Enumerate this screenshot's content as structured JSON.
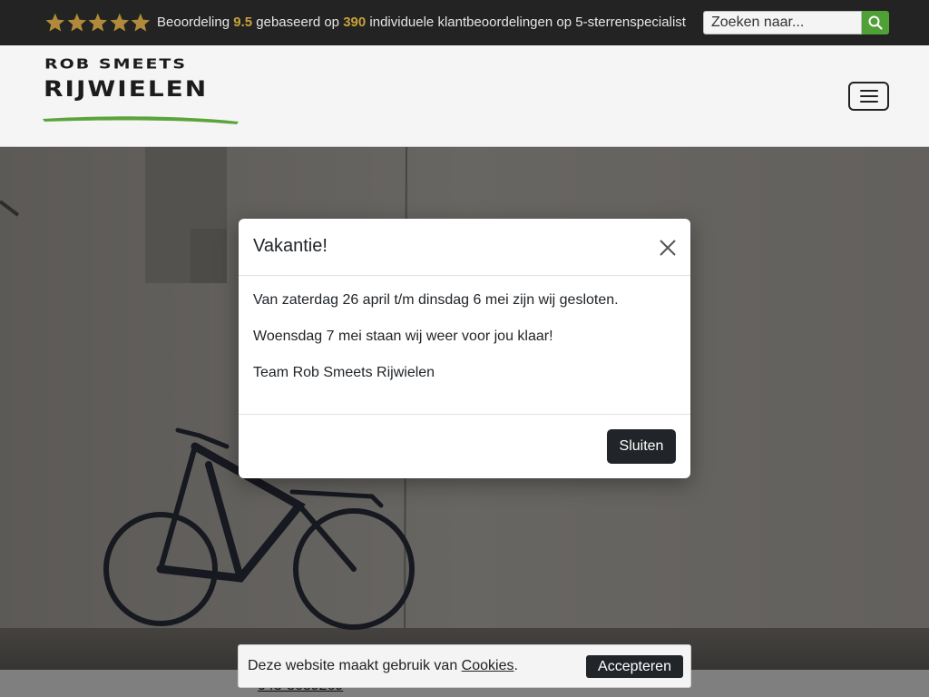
{
  "topbar": {
    "stars_count": 5,
    "star_icon": "star-icon",
    "rating_prefix": "Beoordeling",
    "rating_score": "9.5",
    "rating_middle": "gebaseerd op",
    "review_count": "390",
    "rating_suffix": "individuele klantbeoordelingen op 5-sterrenspecialist",
    "search_placeholder": "Zoeken naar...",
    "search_icon": "search-icon"
  },
  "header": {
    "logo_line1": "ROB SMEETS",
    "logo_line2": "RIJWIELEN",
    "menu_icon": "hamburger-menu-icon"
  },
  "modal": {
    "title": "Vakantie!",
    "close_icon": "close-icon",
    "paragraphs": [
      "Van zaterdag 26 april t/m dinsdag 6 mei zijn wij gesloten.",
      "Woensdag 7 mei staan wij weer voor jou klaar!",
      "Team Rob Smeets Rijwielen"
    ],
    "close_button": "Sluiten"
  },
  "cookie": {
    "text_before": "Deze website maakt gebruik van ",
    "link": "Cookies",
    "text_after": ".",
    "accept_button": "Accepteren"
  },
  "page": {
    "phone": "043-3639269"
  },
  "colors": {
    "topbar_bg": "#232323",
    "star_gold": "#c9a13a",
    "accent_green": "#4fa035",
    "button_dark": "#212529"
  }
}
